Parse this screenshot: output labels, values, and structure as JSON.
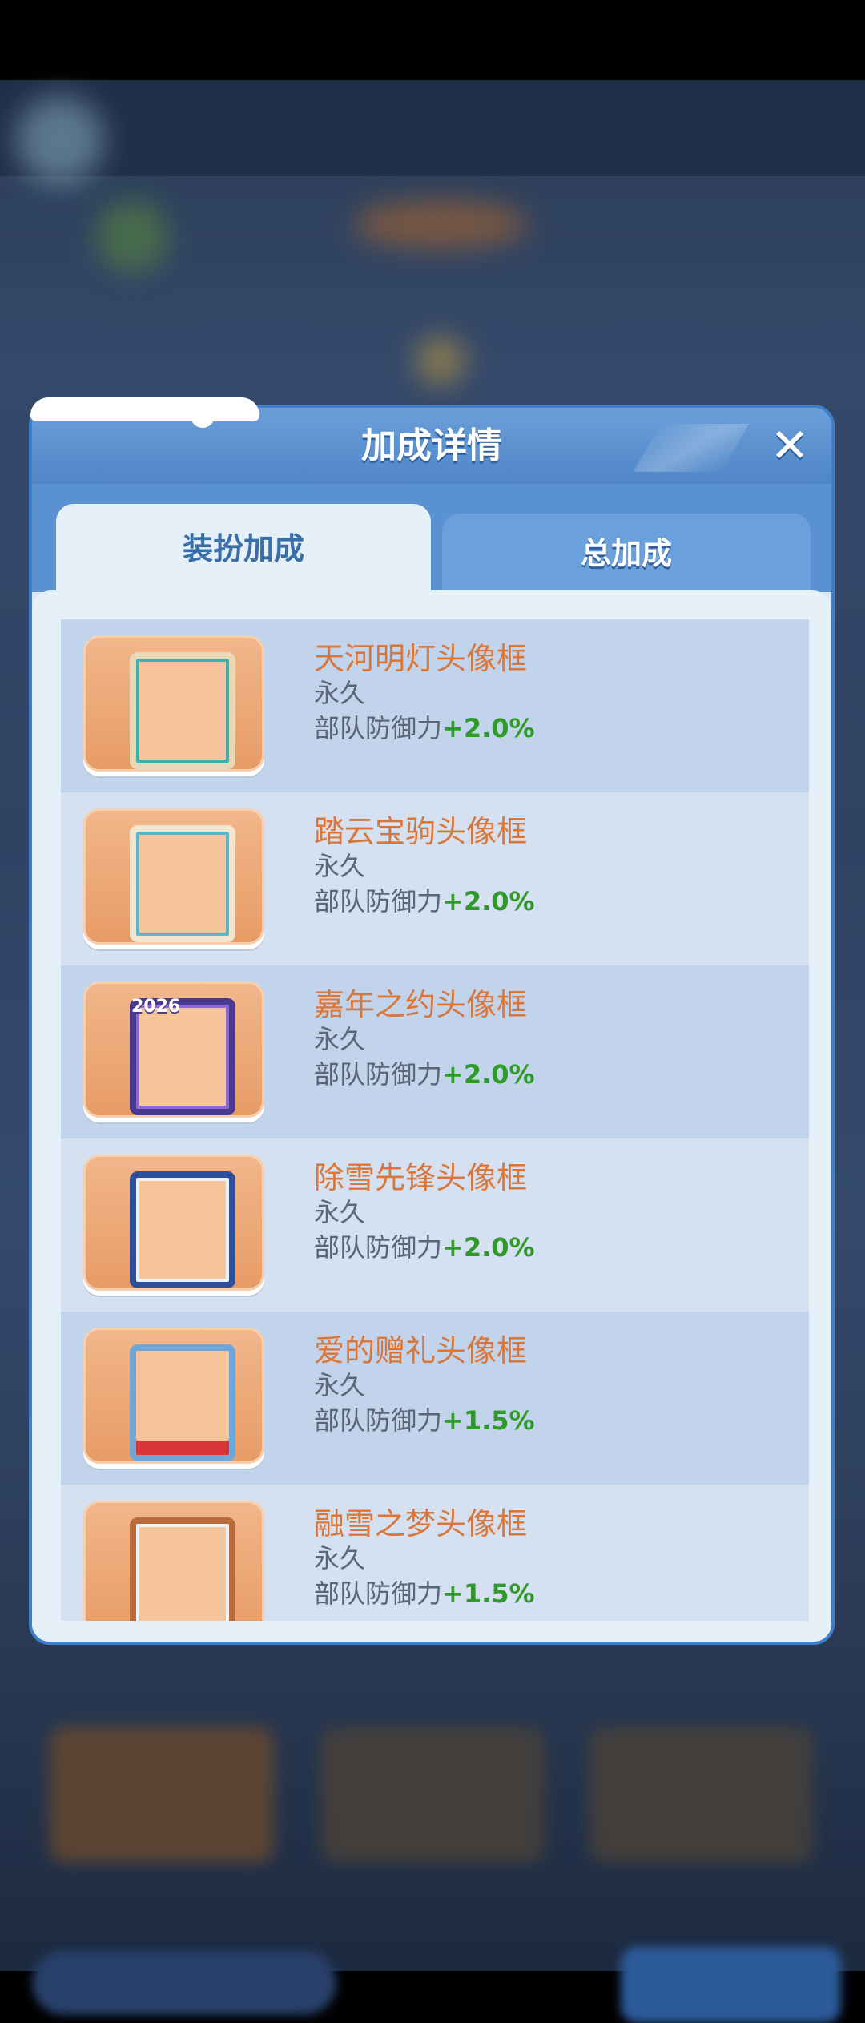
{
  "modal": {
    "title": "加成详情",
    "close_icon": "close-icon"
  },
  "tabs": [
    {
      "label": "装扮加成",
      "active": true
    },
    {
      "label": "总加成",
      "active": false
    }
  ],
  "items": [
    {
      "name": "天河明灯头像框",
      "duration": "永久",
      "stat_label": "部队防御力",
      "stat_value": "+2.0%",
      "frame_colors": [
        "#e7d8b8",
        "#3fb0a6",
        "#c9463a"
      ]
    },
    {
      "name": "踏云宝驹头像框",
      "duration": "永久",
      "stat_label": "部队防御力",
      "stat_value": "+2.0%",
      "frame_colors": [
        "#f0e6cf",
        "#58b6c9",
        "#e2a23c"
      ]
    },
    {
      "name": "嘉年之约头像框",
      "duration": "永久",
      "stat_label": "部队防御力",
      "stat_value": "+2.0%",
      "frame_colors": [
        "#4a3a8f",
        "#f1d33a",
        "#8e6ad0"
      ],
      "frame_text": "2026"
    },
    {
      "name": "除雪先锋头像框",
      "duration": "永久",
      "stat_label": "部队防御力",
      "stat_value": "+2.0%",
      "frame_colors": [
        "#2f4f9a",
        "#e9f1fb",
        "#7da6d8"
      ]
    },
    {
      "name": "爱的赠礼头像框",
      "duration": "永久",
      "stat_label": "部队防御力",
      "stat_value": "+1.5%",
      "frame_colors": [
        "#6fa6d8",
        "#d8343a",
        "#ffffff"
      ]
    },
    {
      "name": "融雪之梦头像框",
      "duration": "永久",
      "stat_label": "部队防御力",
      "stat_value": "+1.5%",
      "frame_colors": [
        "#b96a3a",
        "#e8f4fb",
        "#4d9fd0"
      ]
    }
  ]
}
